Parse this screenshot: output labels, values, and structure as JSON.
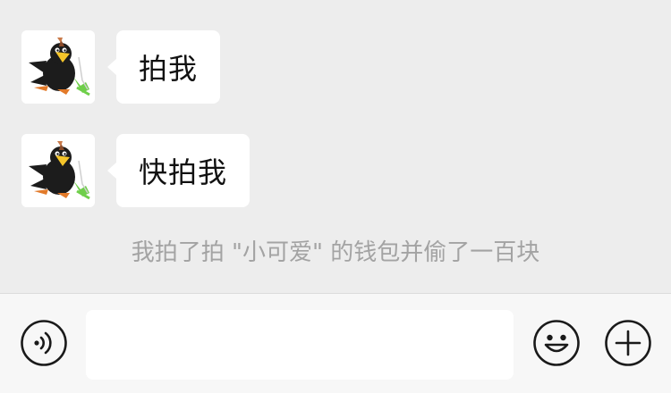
{
  "messages": [
    {
      "sender_avatar": "black-bird-cartoon-avatar",
      "text": "拍我"
    },
    {
      "sender_avatar": "black-bird-cartoon-avatar",
      "text": "快拍我"
    }
  ],
  "system_note": "我拍了拍 \"小可爱\" 的钱包并偷了一百块",
  "input_bar": {
    "voice_icon": "voice-toggle-icon",
    "input_value": "",
    "emoji_icon": "emoji-face-icon",
    "more_icon": "plus-circle-icon"
  },
  "colors": {
    "background": "#ededed",
    "bubble": "#ffffff",
    "note_text": "#a3a3a3",
    "input_bar": "#f7f7f7",
    "icon_stroke": "#1a1a1a"
  }
}
